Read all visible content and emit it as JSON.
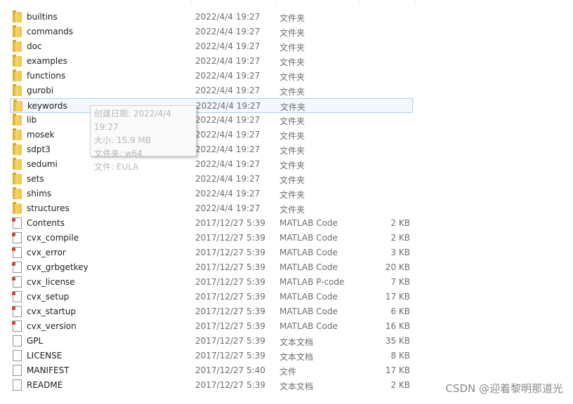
{
  "files": [
    {
      "name": "builtins",
      "date": "2022/4/4 19:27",
      "type": "文件夹",
      "size": "",
      "icon": "folder-icon"
    },
    {
      "name": "commands",
      "date": "2022/4/4 19:27",
      "type": "文件夹",
      "size": "",
      "icon": "folder-icon"
    },
    {
      "name": "doc",
      "date": "2022/4/4 19:27",
      "type": "文件夹",
      "size": "",
      "icon": "folder-icon"
    },
    {
      "name": "examples",
      "date": "2022/4/4 19:27",
      "type": "文件夹",
      "size": "",
      "icon": "folder-icon"
    },
    {
      "name": "functions",
      "date": "2022/4/4 19:27",
      "type": "文件夹",
      "size": "",
      "icon": "folder-icon"
    },
    {
      "name": "gurobi",
      "date": "2022/4/4 19:27",
      "type": "文件夹",
      "size": "",
      "icon": "folder-icon"
    },
    {
      "name": "keywords",
      "date": "2022/4/4 19:27",
      "type": "文件夹",
      "size": "",
      "icon": "folder-icon",
      "selected": true
    },
    {
      "name": "lib",
      "date": "2022/4/4 19:27",
      "type": "文件夹",
      "size": "",
      "icon": "folder-icon"
    },
    {
      "name": "mosek",
      "date": "2022/4/4 19:27",
      "type": "文件夹",
      "size": "",
      "icon": "folder-icon"
    },
    {
      "name": "sdpt3",
      "date": "2022/4/4 19:27",
      "type": "文件夹",
      "size": "",
      "icon": "folder-icon"
    },
    {
      "name": "sedumi",
      "date": "2022/4/4 19:27",
      "type": "文件夹",
      "size": "",
      "icon": "folder-icon"
    },
    {
      "name": "sets",
      "date": "2022/4/4 19:27",
      "type": "文件夹",
      "size": "",
      "icon": "folder-icon"
    },
    {
      "name": "shims",
      "date": "2022/4/4 19:27",
      "type": "文件夹",
      "size": "",
      "icon": "folder-icon"
    },
    {
      "name": "structures",
      "date": "2022/4/4 19:27",
      "type": "文件夹",
      "size": "",
      "icon": "folder-icon"
    },
    {
      "name": "Contents",
      "date": "2017/12/27 5:39",
      "type": "MATLAB Code",
      "size": "2 KB",
      "icon": "matlab-file-icon"
    },
    {
      "name": "cvx_compile",
      "date": "2017/12/27 5:39",
      "type": "MATLAB Code",
      "size": "2 KB",
      "icon": "matlab-file-icon"
    },
    {
      "name": "cvx_error",
      "date": "2017/12/27 5:39",
      "type": "MATLAB Code",
      "size": "3 KB",
      "icon": "matlab-file-icon"
    },
    {
      "name": "cvx_grbgetkey",
      "date": "2017/12/27 5:39",
      "type": "MATLAB Code",
      "size": "20 KB",
      "icon": "matlab-file-icon"
    },
    {
      "name": "cvx_license",
      "date": "2017/12/27 5:39",
      "type": "MATLAB P-code",
      "size": "7 KB",
      "icon": "matlab-pcode-icon"
    },
    {
      "name": "cvx_setup",
      "date": "2017/12/27 5:39",
      "type": "MATLAB Code",
      "size": "17 KB",
      "icon": "matlab-file-icon"
    },
    {
      "name": "cvx_startup",
      "date": "2017/12/27 5:39",
      "type": "MATLAB Code",
      "size": "6 KB",
      "icon": "matlab-file-icon"
    },
    {
      "name": "cvx_version",
      "date": "2017/12/27 5:39",
      "type": "MATLAB Code",
      "size": "16 KB",
      "icon": "matlab-file-icon"
    },
    {
      "name": "GPL",
      "date": "2017/12/27 5:39",
      "type": "文本文档",
      "size": "35 KB",
      "icon": "text-file-icon"
    },
    {
      "name": "LICENSE",
      "date": "2017/12/27 5:39",
      "type": "文本文档",
      "size": "8 KB",
      "icon": "text-file-icon"
    },
    {
      "name": "MANIFEST",
      "date": "2017/12/27 5:40",
      "type": "文件",
      "size": "17 KB",
      "icon": "file-icon"
    },
    {
      "name": "README",
      "date": "2017/12/27 5:39",
      "type": "文本文档",
      "size": "2 KB",
      "icon": "text-file-icon"
    }
  ],
  "tooltip": {
    "lines": [
      "创建日期: 2022/4/4 19:27",
      "大小: 15.9 MB",
      "文件夹: w64",
      "文件: EULA"
    ]
  },
  "watermark": "CSDN @迎着黎明那道光"
}
